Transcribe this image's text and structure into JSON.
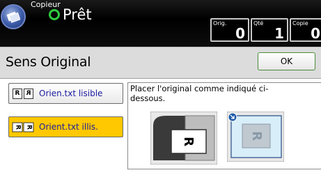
{
  "header": {
    "app_name": "Copieur",
    "status": "Prêt",
    "icon": "copier-app-icon",
    "counters": [
      {
        "label": "Orig.",
        "value": "0"
      },
      {
        "label": "Qté",
        "value": "1"
      },
      {
        "label": "Copie",
        "value": "0"
      }
    ]
  },
  "dialog": {
    "title": "Sens Original",
    "ok_label": "OK"
  },
  "options": [
    {
      "label": "Orien.txt lisible",
      "selected": false,
      "icon": "readable-orientation-icon"
    },
    {
      "label": "Orient.txt illis.",
      "selected": true,
      "icon": "unreadable-orientation-icon"
    }
  ],
  "instruction": "Placer l'original comme indiqué ci-dessous.",
  "colors": {
    "header_bg": "#000000",
    "ready_green": "#2ecc40",
    "selected_bg": "#ffc800",
    "option_text": "#1a1aa0",
    "ok_border": "#4a8b3a"
  }
}
